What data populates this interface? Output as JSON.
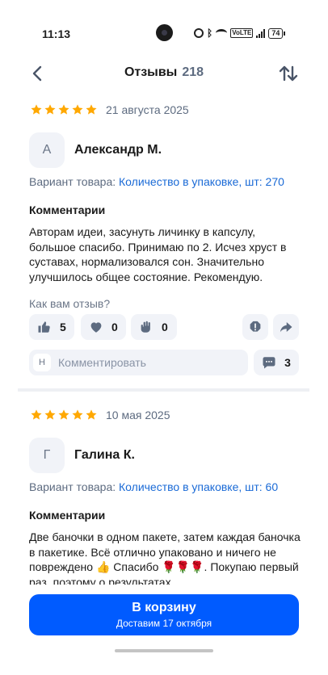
{
  "status_bar": {
    "time": "11:13",
    "battery": "74",
    "volte": "VoLTE"
  },
  "header": {
    "title": "Отзывы",
    "count": "218"
  },
  "colors": {
    "accent": "#005bff",
    "link": "#1a6ad6",
    "star": "#ffa800"
  },
  "reviews": [
    {
      "rating": 5,
      "date": "21 августа 2025",
      "avatar_letter": "А",
      "author": "Александр М.",
      "variant_label": "Вариант товара: ",
      "variant_value": "Количество в упаковке, шт: 270",
      "comment_heading": "Комментарии",
      "comment_text": "Авторам идеи, засунуть личинку в капсулу, большое спасибо. Принимаю по 2. Исчез хруст в суставах, нормализовался сон. Значительно улучшилось общее состояние. Рекомендую.",
      "question": "Как вам отзыв?",
      "likes": "5",
      "hearts": "0",
      "claps": "0",
      "comment_avatar": "Н",
      "comment_placeholder": "Комментировать",
      "comments_count": "3"
    },
    {
      "rating": 5,
      "date": "10 мая 2025",
      "avatar_letter": "Г",
      "author": "Галина К.",
      "variant_label": "Вариант товара: ",
      "variant_value": "Количество в упаковке, шт: 60",
      "comment_heading": "Комментарии",
      "comment_text": "Две баночки в одном пакете, затем каждая баночка в пакетике. Всё отлично упаковано и ничего не повреждено 👍 Спасибо 🌹🌹🌹. Покупаю первый раз, поэтому о результатах"
    }
  ],
  "cta": {
    "label": "В корзину",
    "sub": "Доставим 17 октября"
  },
  "icons": {
    "back": "chevron-left-icon",
    "sort": "sort-arrows-icon",
    "like": "thumbs-up-icon",
    "heart": "heart-icon",
    "clap": "clapping-hands-icon",
    "report": "warning-icon",
    "share": "share-icon",
    "comments": "speech-bubble-icon"
  }
}
